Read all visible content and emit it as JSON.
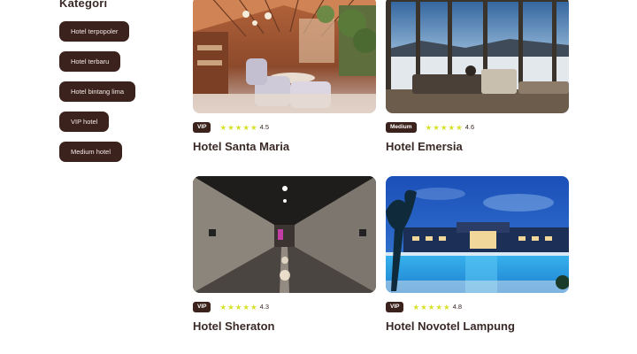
{
  "sidebar": {
    "title": "Kategori",
    "categories": [
      "Hotel terpopoler",
      "Hotel terbaru",
      "Hotel bintang lima",
      "VIP hotel",
      "Medium hotel"
    ]
  },
  "hotels": [
    {
      "name": "Hotel Santa Maria",
      "badge": "VIP",
      "rating": "4.5",
      "stars": 5
    },
    {
      "name": "Hotel Emersia",
      "badge": "Medium",
      "rating": "4.6",
      "stars": 5
    },
    {
      "name": "Hotel Sheraton",
      "badge": "VIP",
      "rating": "4.3",
      "stars": 5
    },
    {
      "name": "Hotel Novotel Lampung",
      "badge": "VIP",
      "rating": "4.8",
      "stars": 5
    }
  ],
  "colors": {
    "accent": "#3c221d",
    "star": "#d7e12a",
    "text": "#3a2a27"
  },
  "icons": {
    "star": "star-icon"
  }
}
